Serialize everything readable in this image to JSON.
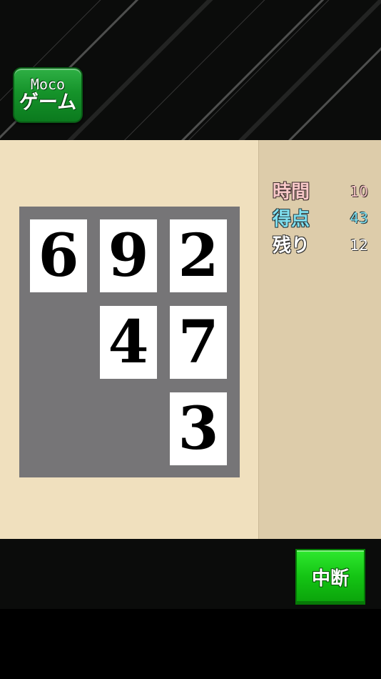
{
  "header": {
    "moco_button": {
      "line1": "Moco",
      "line2": "ゲーム"
    }
  },
  "board": {
    "tiles": [
      {
        "value": "6",
        "row": 1,
        "col": 1
      },
      {
        "value": "9",
        "row": 1,
        "col": 2
      },
      {
        "value": "2",
        "row": 1,
        "col": 3
      },
      {
        "value": "4",
        "row": 2,
        "col": 2
      },
      {
        "value": "7",
        "row": 2,
        "col": 3
      },
      {
        "value": "3",
        "row": 3,
        "col": 3
      }
    ]
  },
  "stats": {
    "time": {
      "label": "時間",
      "value": "10"
    },
    "score": {
      "label": "得点",
      "value": "43"
    },
    "remain": {
      "label": "残り",
      "value": "12"
    }
  },
  "footer": {
    "pause_label": "中断"
  },
  "colors": {
    "play_area": "#f0e0be",
    "side_panel": "#ddccaa",
    "board": "#767577",
    "button_green": "#14c414"
  }
}
